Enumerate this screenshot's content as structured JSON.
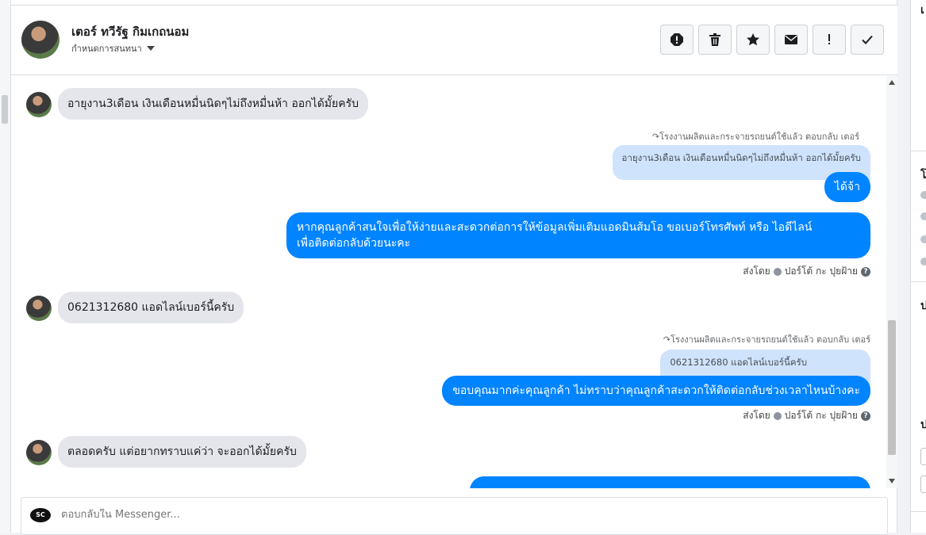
{
  "contact": {
    "name": "เตอร์ ทวีรัฐ กิมเกถนอม",
    "subtitle": "กำหนดการสนทนา"
  },
  "toolbar": {
    "buttons": [
      {
        "name": "report-icon",
        "label": "report"
      },
      {
        "name": "trash-icon",
        "label": "delete"
      },
      {
        "name": "star-icon",
        "label": "star"
      },
      {
        "name": "envelope-icon",
        "label": "mark unread"
      },
      {
        "name": "exclamation-icon",
        "label": "spam"
      },
      {
        "name": "check-icon",
        "label": "done"
      }
    ]
  },
  "messages": {
    "m1": "อายุงาน3เดือน เงินเดือนหมื่นนิดๆไม่ถึงหมื่นห้า ออกได้มั้ยครับ",
    "r1_label": "โรงงานผลิตและกระจายรถยนต์ใช้แล้ว ตอบกลับ เตอร์",
    "r1_quote": "อายุงาน3เดือน เงินเดือนหมื่นนิดๆไม่ถึงหมื่นห้า ออกได้มั้ยครับ",
    "r1_reply": "ได้จ้า",
    "o2_line1": "หากคุณลูกค้าสนใจเพื่อให้ง่ายและสะดวกต่อการให้ข้อมูลเพิ่มเติมแอดมินส้มโอ ขอเบอร์โทรศัพท์ หรือ ไอดีไลน์",
    "o2_line2": "เพื่อติดต่อกลับด้วยนะคะ",
    "sentby_prefix": "ส่งโดย",
    "sentby_name": "ปอร์โต้ กะ ปุยฝ้าย",
    "m3": "0621312680 แอดไลน์เบอร์นี้ครับ",
    "r3_label": "โรงงานผลิตและกระจายรถยนต์ใช้แล้ว ตอบกลับ เตอร์",
    "r3_quote": "0621312680 แอดไลน์เบอร์นี้ครับ",
    "r3_reply": "ขอบคุณมากค่ะคุณลูกค้า ไม่ทราบว่าคุณลูกค้าสะดวกให้ติดต่อกลับช่วงเวลาไหนบ้างคะ",
    "m4": "ตลอดครับ แต่อยากทราบแค่ว่า จะออกได้มั้ยครับ"
  },
  "composer": {
    "placeholder": "ตอบกลับใน Messenger..."
  },
  "right_panel": {
    "heading1": "โ",
    "heading2": "ป",
    "heading3": "ป"
  }
}
